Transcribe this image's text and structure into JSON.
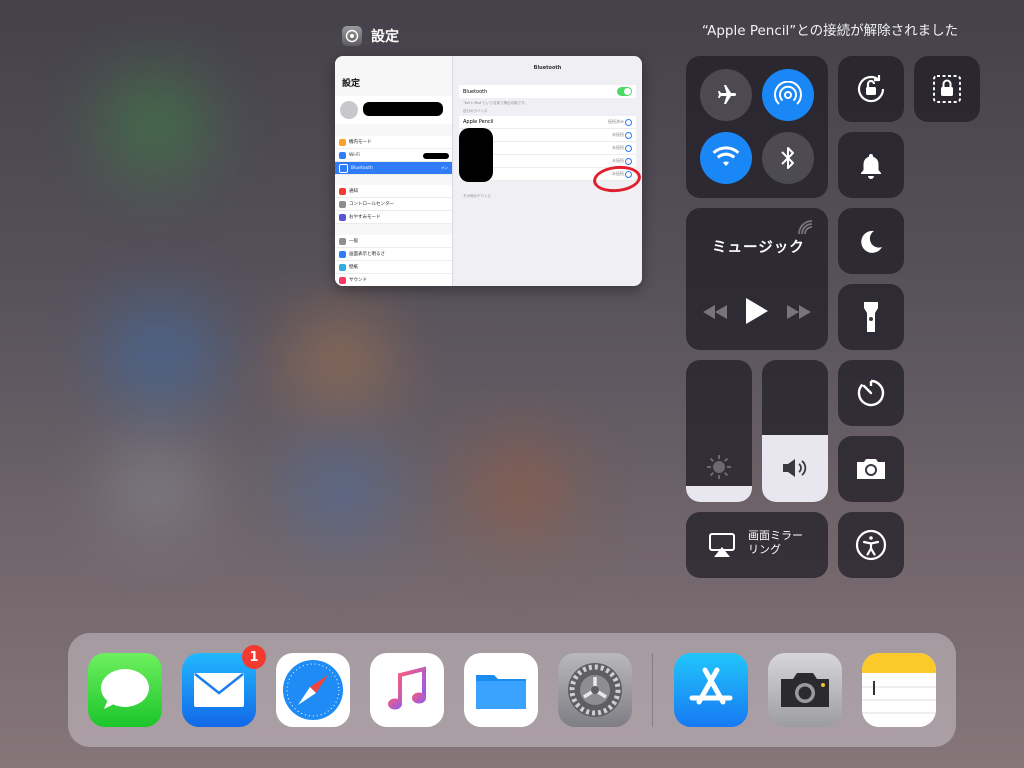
{
  "banner": {
    "text": "“Apple Pencil”との接続が解除されました"
  },
  "app_switcher": {
    "app_name": "設定",
    "screenshot": {
      "sidebar_title": "設定",
      "nav_title": "Bluetooth",
      "bluetooth_label": "Bluetooth",
      "visible_note": "\"Kei's iPad\"という名前で検出可能です。",
      "my_devices_header": "自分のデバイス",
      "other_devices_header": "その他のデバイス",
      "pencil_name": "Apple Pencil",
      "pencil_status": "接続済み",
      "not_connected": "未接続",
      "sidebar_items_1": [
        "機内モード",
        "Wi-Fi",
        "Bluetooth"
      ],
      "sidebar_items_2": [
        "通知",
        "コントロールセンター",
        "おやすみモード"
      ],
      "sidebar_items_3": [
        "一般",
        "画面表示と明るさ",
        "壁紙",
        "サウンド"
      ],
      "bluetooth_state": "オン"
    }
  },
  "control_center": {
    "music_title": "ミュージック",
    "screen_mirroring_label": "画面ミラー\nリング",
    "brightness_level": 0.11,
    "volume_level": 0.47,
    "toggles": {
      "airplane": false,
      "airdrop": true,
      "wifi": true,
      "bluetooth": false
    },
    "colors": {
      "active": "#1a87f7"
    }
  },
  "dock": {
    "mail_badge": "1",
    "apps": [
      "messages",
      "mail",
      "safari",
      "music",
      "files",
      "settings",
      "app-store",
      "camera",
      "notes"
    ]
  }
}
